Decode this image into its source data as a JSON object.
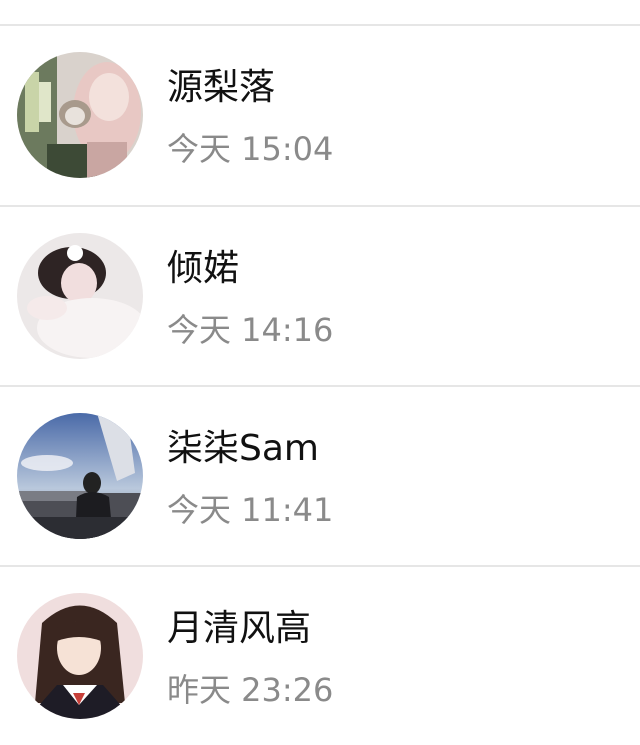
{
  "contacts": [
    {
      "name": "源梨落",
      "time": "今天 15:04",
      "avatar": "avatar-girl-with-cat"
    },
    {
      "name": "倾婼",
      "time": "今天 14:16",
      "avatar": "avatar-girl-lying"
    },
    {
      "name": "柒柒Sam",
      "time": "今天 11:41",
      "avatar": "avatar-city-balcony"
    },
    {
      "name": "月清风高",
      "time": "昨天 23:26",
      "avatar": "avatar-anime-sailor-girl"
    }
  ],
  "colors": {
    "name_text": "#111111",
    "time_text": "#8a8a8a",
    "divider": "#e6e6e6",
    "background": "#ffffff"
  }
}
